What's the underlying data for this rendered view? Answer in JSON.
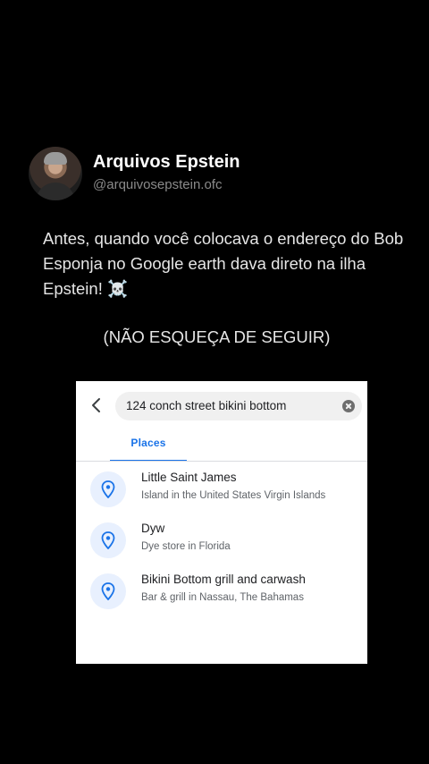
{
  "post": {
    "author_name": "Arquivos Epstein",
    "author_handle": "@arquivosepstein.ofc",
    "caption": "Antes, quando você colocava o endereço do Bob Esponja no Google earth dava direto na ilha Epstein! ☠️",
    "follow_note": "(NÃO ESQUEÇA DE SEGUIR)"
  },
  "embedded_screenshot": {
    "search_query": "124 conch street bikini bottom",
    "tab_label": "Places",
    "accent_color": "#1a73e8",
    "icons": {
      "back": "chevron-left-icon",
      "clear": "clear-icon",
      "place": "location-pin-icon"
    },
    "results": [
      {
        "title": "Little Saint James",
        "subtitle": "Island in the United States Virgin Islands"
      },
      {
        "title": "Dyw",
        "subtitle": "Dye store in Florida"
      },
      {
        "title": "Bikini Bottom grill and carwash",
        "subtitle": "Bar & grill in Nassau, The Bahamas"
      }
    ]
  }
}
